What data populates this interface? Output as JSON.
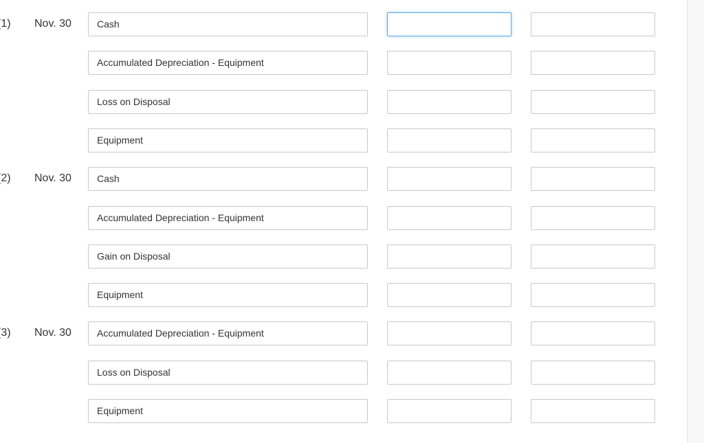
{
  "entries": [
    {
      "number": "(1)",
      "date": "Nov. 30",
      "accounts": [
        "Cash",
        "Accumulated Depreciation - Equipment",
        "Loss on Disposal",
        "Equipment"
      ]
    },
    {
      "number": "(2)",
      "date": "Nov. 30",
      "accounts": [
        "Cash",
        "Accumulated Depreciation - Equipment",
        "Gain on Disposal",
        "Equipment"
      ]
    },
    {
      "number": "(3)",
      "date": "Nov. 30",
      "accounts": [
        "Accumulated Depreciation - Equipment",
        "Loss on Disposal",
        "Equipment"
      ]
    }
  ],
  "focus_color": "#5aa9e6"
}
